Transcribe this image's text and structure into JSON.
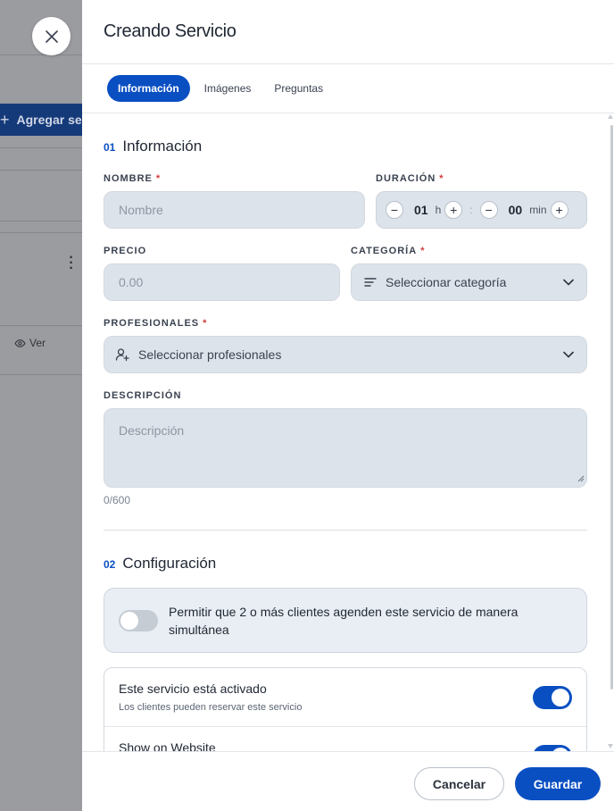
{
  "background": {
    "add_button_label": "Agregar se",
    "view_label": "Ver"
  },
  "drawer": {
    "title": "Creando Servicio",
    "tabs": [
      {
        "label": "Información",
        "active": true
      },
      {
        "label": "Imágenes",
        "active": false
      },
      {
        "label": "Preguntas",
        "active": false
      }
    ]
  },
  "section1": {
    "number": "01",
    "title": "Información"
  },
  "fields": {
    "name": {
      "label": "NOMBRE",
      "required": "*",
      "placeholder": "Nombre"
    },
    "duration": {
      "label": "DURACIÓN",
      "required": "*",
      "hours": "01",
      "hours_unit": "h",
      "separator": ":",
      "minutes": "00",
      "minutes_unit": "min",
      "minus": "−",
      "plus": "+"
    },
    "price": {
      "label": "PRECIO",
      "placeholder": "0.00"
    },
    "category": {
      "label": "CATEGORÍA",
      "required": "*",
      "value": "Seleccionar categoría"
    },
    "professionals": {
      "label": "PROFESIONALES",
      "required": "*",
      "value": "Seleccionar profesionales"
    },
    "description": {
      "label": "DESCRIPCIÓN",
      "placeholder": "Descripción",
      "counter": "0/600"
    }
  },
  "section2": {
    "number": "02",
    "title": "Configuración"
  },
  "config": {
    "simultaneous": {
      "text": "Permitir que 2 o más clientes agenden este servicio de manera simultánea",
      "enabled": false
    },
    "active": {
      "title": "Este servicio está activado",
      "subtitle": "Los clientes pueden reservar este servicio",
      "enabled": true
    },
    "website": {
      "title": "Show on Website",
      "enabled": true
    }
  },
  "footer": {
    "cancel_label": "Cancelar",
    "save_label": "Guardar"
  },
  "colors": {
    "accent": "#0a4fc2",
    "required": "#d23b3b",
    "input_bg": "#dde3ea"
  }
}
